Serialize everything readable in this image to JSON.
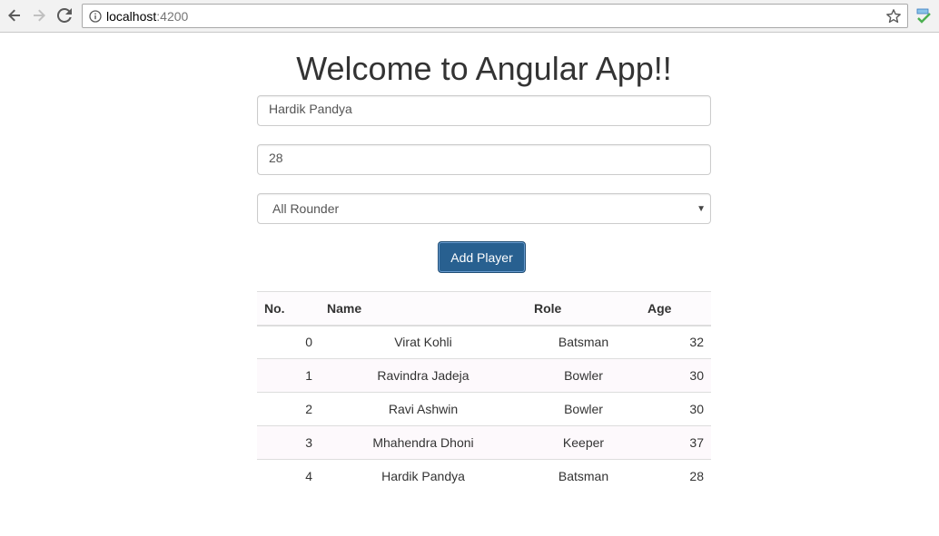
{
  "browser": {
    "url_host": "localhost",
    "url_port": ":4200",
    "icons": [
      "back-arrow-icon",
      "forward-arrow-icon",
      "reload-icon",
      "info-icon",
      "star-icon",
      "extension-icon"
    ]
  },
  "page": {
    "title": "Welcome to Angular App!!",
    "form": {
      "name_value": "Hardik Pandya",
      "age_value": "28",
      "role_selected": "All Rounder",
      "submit_label": "Add Player"
    },
    "table": {
      "headers": [
        "No.",
        "Name",
        "Role",
        "Age"
      ],
      "rows": [
        {
          "no": "0",
          "name": "Virat Kohli",
          "role": "Batsman",
          "age": "32"
        },
        {
          "no": "1",
          "name": "Ravindra Jadeja",
          "role": "Bowler",
          "age": "30"
        },
        {
          "no": "2",
          "name": "Ravi Ashwin",
          "role": "Bowler",
          "age": "30"
        },
        {
          "no": "3",
          "name": "Mhahendra Dhoni",
          "role": "Keeper",
          "age": "37"
        },
        {
          "no": "4",
          "name": "Hardik Pandya",
          "role": "Batsman",
          "age": "28"
        }
      ]
    },
    "colors": {
      "button_bg": "#286090",
      "text": "#333333"
    }
  }
}
